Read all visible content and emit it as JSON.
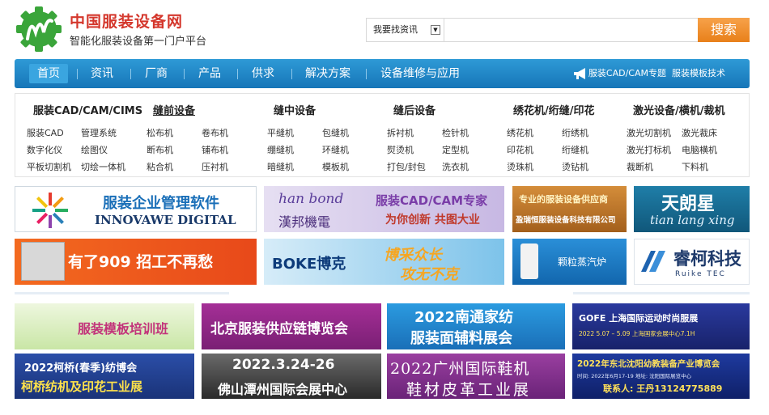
{
  "header": {
    "site_title": "中国服装设备网",
    "slogan": "智能化服装设备第一门户平台",
    "search": {
      "select_value": "我要找资讯",
      "button_label": "搜索",
      "placeholder": ""
    }
  },
  "nav": {
    "items": [
      "首页",
      "资讯",
      "厂商",
      "产品",
      "供求",
      "解决方案",
      "设备维修与应用"
    ],
    "right_links": [
      "服装CAD/CAM专题",
      "服装模板技术"
    ]
  },
  "categories": [
    {
      "title": "服装CAD/CAM/CIMS",
      "items": [
        "服装CAD",
        "管理系统",
        "数字化仪",
        "绘图仪",
        "平板切割机",
        "切绘一体机"
      ]
    },
    {
      "title": "缝前设备",
      "items": [
        "松布机",
        "卷布机",
        "断布机",
        "铺布机",
        "粘合机",
        "压衬机"
      ]
    },
    {
      "title": "缝中设备",
      "items": [
        "平缝机",
        "包缝机",
        "绷缝机",
        "环缝机",
        "暗缝机",
        "模板机"
      ]
    },
    {
      "title": "缝后设备",
      "items": [
        "拆衬机",
        "检针机",
        "熨烫机",
        "定型机",
        "打包/封包",
        "洗衣机"
      ]
    },
    {
      "title": "绣花机/绗缝/印花",
      "items": [
        "绣花机",
        "绗绣机",
        "印花机",
        "绗缝机",
        "烫珠机",
        "烫钻机"
      ]
    },
    {
      "title": "激光设备/横机/裁机",
      "items": [
        "激光切割机",
        "激光裁床",
        "激光打标机",
        "电脑横机",
        "裁断机",
        "下料机"
      ]
    }
  ],
  "banners_row1": {
    "innowave": {
      "title": "服装企业管理软件",
      "subtitle": "INNOVAWE DIGITAL"
    },
    "hanbond": {
      "logo": "han bond",
      "logo_cn": "漢邦機電",
      "line1": "服装CAD/CAM专家",
      "line2": "为你创新 共图大业"
    },
    "yingruiheng": {
      "line1": "专业的服装设备供应商",
      "line2": "盈瑞恒服装设备科技有限公司"
    },
    "tianlangxing": {
      "cn": "天朗星",
      "en": "tian lang xing"
    }
  },
  "banners_row2": {
    "b909": {
      "text": "有了909 招工不再愁"
    },
    "boke": {
      "logo": "BOKE博克",
      "line1": "博采众长",
      "line2": "攻无不克"
    },
    "steam": {
      "text": "颗粒蒸汽炉"
    },
    "ruike": {
      "cn": "睿柯科技",
      "en": "Ruike TEC"
    }
  },
  "banners_row3": [
    {
      "text": "服装模板培训班"
    },
    {
      "text": "北京服装供应链博览会"
    },
    {
      "line1": "2022南通家纺",
      "line2": "服装面辅料展会"
    },
    {
      "line1": "GOFE 上海国际运动时尚服展",
      "line2": "2022 5.07 – 5.09 上海国家会展中心7.1H"
    }
  ],
  "banners_row4": [
    {
      "line1": "2022柯桥(春季)纺博会",
      "line2": "柯桥纺机及印花工业展"
    },
    {
      "line1": "2022.3.24-26",
      "line2": "佛山潭州国际会展中心"
    },
    {
      "line1": "2022广州国际鞋机",
      "line2": "鞋材皮革工业展"
    },
    {
      "line1": "2022年东北沈阳幼教装备产业博览会",
      "line2": "时间: 2022年6月17-19    地址: 沈阳国际展览中心",
      "line3": "联系人: 王丹13124775889"
    }
  ]
}
